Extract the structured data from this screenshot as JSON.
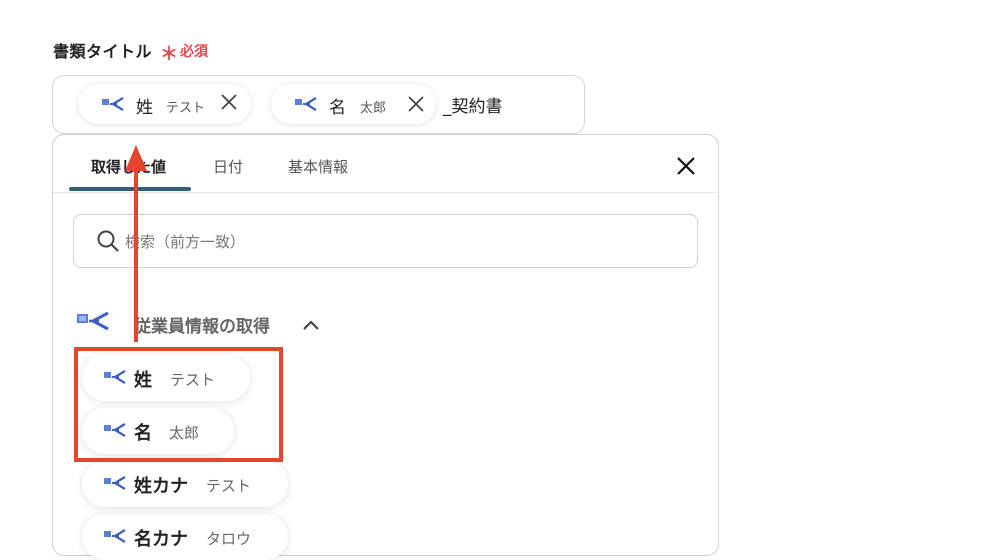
{
  "field": {
    "label": "書類タイトル",
    "required_mark": "＊",
    "required_text": "必須"
  },
  "title_input": {
    "chips": [
      {
        "name": "姓",
        "value": "テスト",
        "icon": "smarthr-logo-icon",
        "remove_icon": "close-icon"
      },
      {
        "name": "名",
        "value": "太郎",
        "icon": "smarthr-logo-icon",
        "remove_icon": "close-icon"
      }
    ],
    "suffix": "_契約書"
  },
  "panel": {
    "tabs": [
      {
        "label": "取得した値",
        "active": true
      },
      {
        "label": "日付",
        "active": false
      },
      {
        "label": "基本情報",
        "active": false
      }
    ],
    "close_icon": "close-icon",
    "search": {
      "placeholder": "検索（前方一致）",
      "icon": "search-icon"
    },
    "section": {
      "title": "従業員情報の取得",
      "icon": "smarthr-logo-icon",
      "expanded_icon": "chevron-up-icon"
    },
    "items": [
      {
        "name": "姓",
        "value": "テスト"
      },
      {
        "name": "名",
        "value": "太郎"
      },
      {
        "name": "姓カナ",
        "value": "テスト"
      },
      {
        "name": "名カナ",
        "value": "タロウ"
      }
    ]
  },
  "annotation": {
    "color": "#e5452c"
  }
}
